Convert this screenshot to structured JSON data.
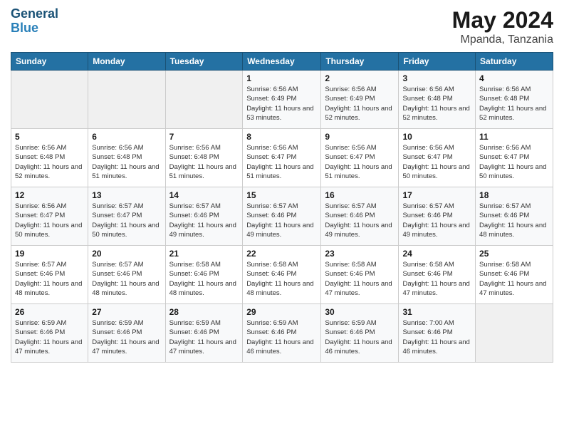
{
  "header": {
    "logo_line1": "General",
    "logo_line2": "Blue",
    "month_year": "May 2024",
    "location": "Mpanda, Tanzania"
  },
  "weekdays": [
    "Sunday",
    "Monday",
    "Tuesday",
    "Wednesday",
    "Thursday",
    "Friday",
    "Saturday"
  ],
  "weeks": [
    [
      {
        "day": "",
        "info": ""
      },
      {
        "day": "",
        "info": ""
      },
      {
        "day": "",
        "info": ""
      },
      {
        "day": "1",
        "info": "Sunrise: 6:56 AM\nSunset: 6:49 PM\nDaylight: 11 hours\nand 53 minutes."
      },
      {
        "day": "2",
        "info": "Sunrise: 6:56 AM\nSunset: 6:49 PM\nDaylight: 11 hours\nand 52 minutes."
      },
      {
        "day": "3",
        "info": "Sunrise: 6:56 AM\nSunset: 6:48 PM\nDaylight: 11 hours\nand 52 minutes."
      },
      {
        "day": "4",
        "info": "Sunrise: 6:56 AM\nSunset: 6:48 PM\nDaylight: 11 hours\nand 52 minutes."
      }
    ],
    [
      {
        "day": "5",
        "info": "Sunrise: 6:56 AM\nSunset: 6:48 PM\nDaylight: 11 hours\nand 52 minutes."
      },
      {
        "day": "6",
        "info": "Sunrise: 6:56 AM\nSunset: 6:48 PM\nDaylight: 11 hours\nand 51 minutes."
      },
      {
        "day": "7",
        "info": "Sunrise: 6:56 AM\nSunset: 6:48 PM\nDaylight: 11 hours\nand 51 minutes."
      },
      {
        "day": "8",
        "info": "Sunrise: 6:56 AM\nSunset: 6:47 PM\nDaylight: 11 hours\nand 51 minutes."
      },
      {
        "day": "9",
        "info": "Sunrise: 6:56 AM\nSunset: 6:47 PM\nDaylight: 11 hours\nand 51 minutes."
      },
      {
        "day": "10",
        "info": "Sunrise: 6:56 AM\nSunset: 6:47 PM\nDaylight: 11 hours\nand 50 minutes."
      },
      {
        "day": "11",
        "info": "Sunrise: 6:56 AM\nSunset: 6:47 PM\nDaylight: 11 hours\nand 50 minutes."
      }
    ],
    [
      {
        "day": "12",
        "info": "Sunrise: 6:56 AM\nSunset: 6:47 PM\nDaylight: 11 hours\nand 50 minutes."
      },
      {
        "day": "13",
        "info": "Sunrise: 6:57 AM\nSunset: 6:47 PM\nDaylight: 11 hours\nand 50 minutes."
      },
      {
        "day": "14",
        "info": "Sunrise: 6:57 AM\nSunset: 6:46 PM\nDaylight: 11 hours\nand 49 minutes."
      },
      {
        "day": "15",
        "info": "Sunrise: 6:57 AM\nSunset: 6:46 PM\nDaylight: 11 hours\nand 49 minutes."
      },
      {
        "day": "16",
        "info": "Sunrise: 6:57 AM\nSunset: 6:46 PM\nDaylight: 11 hours\nand 49 minutes."
      },
      {
        "day": "17",
        "info": "Sunrise: 6:57 AM\nSunset: 6:46 PM\nDaylight: 11 hours\nand 49 minutes."
      },
      {
        "day": "18",
        "info": "Sunrise: 6:57 AM\nSunset: 6:46 PM\nDaylight: 11 hours\nand 48 minutes."
      }
    ],
    [
      {
        "day": "19",
        "info": "Sunrise: 6:57 AM\nSunset: 6:46 PM\nDaylight: 11 hours\nand 48 minutes."
      },
      {
        "day": "20",
        "info": "Sunrise: 6:57 AM\nSunset: 6:46 PM\nDaylight: 11 hours\nand 48 minutes."
      },
      {
        "day": "21",
        "info": "Sunrise: 6:58 AM\nSunset: 6:46 PM\nDaylight: 11 hours\nand 48 minutes."
      },
      {
        "day": "22",
        "info": "Sunrise: 6:58 AM\nSunset: 6:46 PM\nDaylight: 11 hours\nand 48 minutes."
      },
      {
        "day": "23",
        "info": "Sunrise: 6:58 AM\nSunset: 6:46 PM\nDaylight: 11 hours\nand 47 minutes."
      },
      {
        "day": "24",
        "info": "Sunrise: 6:58 AM\nSunset: 6:46 PM\nDaylight: 11 hours\nand 47 minutes."
      },
      {
        "day": "25",
        "info": "Sunrise: 6:58 AM\nSunset: 6:46 PM\nDaylight: 11 hours\nand 47 minutes."
      }
    ],
    [
      {
        "day": "26",
        "info": "Sunrise: 6:59 AM\nSunset: 6:46 PM\nDaylight: 11 hours\nand 47 minutes."
      },
      {
        "day": "27",
        "info": "Sunrise: 6:59 AM\nSunset: 6:46 PM\nDaylight: 11 hours\nand 47 minutes."
      },
      {
        "day": "28",
        "info": "Sunrise: 6:59 AM\nSunset: 6:46 PM\nDaylight: 11 hours\nand 47 minutes."
      },
      {
        "day": "29",
        "info": "Sunrise: 6:59 AM\nSunset: 6:46 PM\nDaylight: 11 hours\nand 46 minutes."
      },
      {
        "day": "30",
        "info": "Sunrise: 6:59 AM\nSunset: 6:46 PM\nDaylight: 11 hours\nand 46 minutes."
      },
      {
        "day": "31",
        "info": "Sunrise: 7:00 AM\nSunset: 6:46 PM\nDaylight: 11 hours\nand 46 minutes."
      },
      {
        "day": "",
        "info": ""
      }
    ]
  ]
}
